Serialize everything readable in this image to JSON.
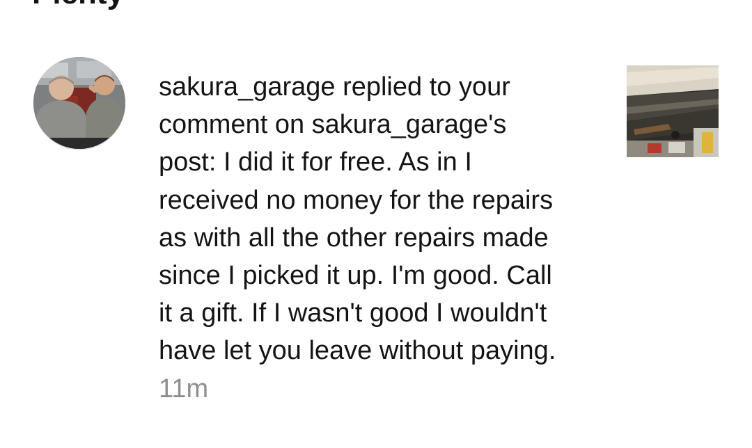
{
  "section": {
    "heading": "Plenty"
  },
  "notification": {
    "avatar_icon": "user-avatar-photo",
    "thumbnail_icon": "post-thumbnail-photo",
    "lines": [
      "sakura_garage replied to your",
      "comment on sakura_garage's",
      "post: I did it for free. As in I",
      "received no money for the repairs",
      "as with all the other repairs made",
      "since I picked it up. I'm good. Call",
      "it a gift. If I wasn't good I wouldn't",
      "have let you leave without paying."
    ],
    "time": "11m"
  },
  "colors": {
    "text": "#141414",
    "muted": "#8e8e8e",
    "background": "#ffffff"
  }
}
